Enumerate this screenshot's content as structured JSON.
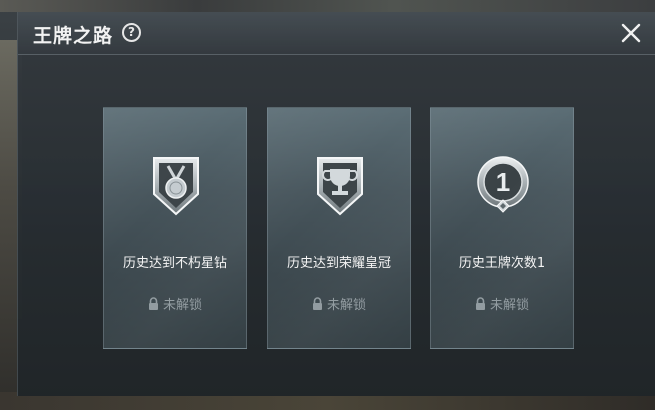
{
  "header": {
    "title": "王牌之路",
    "help_icon": "question-circle-icon",
    "close_icon": "close-icon"
  },
  "cards": [
    {
      "label": "历史达到不朽星钻",
      "badge_icon": "medal-shield-icon",
      "status": "未解锁",
      "status_icon": "lock-icon"
    },
    {
      "label": "历史达到荣耀皇冠",
      "badge_icon": "trophy-shield-icon",
      "status": "未解锁",
      "status_icon": "lock-icon"
    },
    {
      "label": "历史王牌次数1",
      "badge_icon": "number-one-medal-icon",
      "status": "未解锁",
      "status_icon": "lock-icon"
    }
  ],
  "colors": {
    "title_text": "#f2f2f2",
    "card_label": "#f4f4f4",
    "locked_text": "#8f999e",
    "badge_silver": "#c9cfd2"
  }
}
